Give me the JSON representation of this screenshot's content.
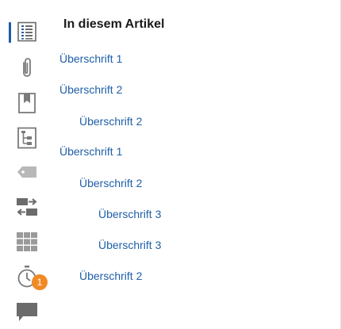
{
  "rail": {
    "items": [
      {
        "icon": "article-toc-icon",
        "active": true
      },
      {
        "icon": "paperclip-icon"
      },
      {
        "icon": "bookmark-icon"
      },
      {
        "icon": "tree-structure-icon"
      },
      {
        "icon": "tag-icon"
      },
      {
        "icon": "swap-icon"
      },
      {
        "icon": "grid-icon"
      },
      {
        "icon": "timer-icon",
        "badge": "1"
      },
      {
        "icon": "comment-icon"
      }
    ],
    "accent": "#1e5aa8",
    "badge_color": "#f08a24"
  },
  "toc": {
    "heading": "In diesem Artikel",
    "items": [
      {
        "label": "Überschrift 1",
        "level": 1
      },
      {
        "label": "Überschrift 2",
        "level": 1
      },
      {
        "label": "Überschrift 2",
        "level": 2
      },
      {
        "label": "Überschrift 1",
        "level": 1
      },
      {
        "label": "Überschrift 2",
        "level": 2
      },
      {
        "label": "Überschrift 3",
        "level": 3
      },
      {
        "label": "Überschrift 3",
        "level": 3
      },
      {
        "label": "Überschrift 2",
        "level": 2
      }
    ],
    "link_color": "#1f5fa8"
  }
}
